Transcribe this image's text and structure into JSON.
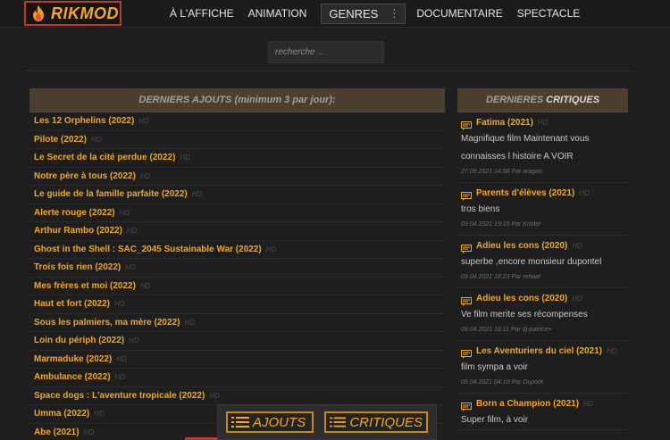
{
  "header": {
    "logo_text": "RIKMOD",
    "nav": [
      "À L'AFFICHE",
      "ANIMATION"
    ],
    "genres_label": "GENRES",
    "nav_after": [
      "DOCUMENTAIRE",
      "SPECTACLE"
    ]
  },
  "search": {
    "placeholder": "recherche ..."
  },
  "latest": {
    "heading": "DERNIERS AJOUTS (minimum 3 par jour):",
    "hd_label": "HD",
    "items": [
      "Les 12 Orphelins (2022)",
      "Pilote (2022)",
      "Le Secret de la cité perdue (2022)",
      "Notre père à tous (2022)",
      "Le guide de la famille parfaite (2022)",
      "Alerte rouge (2022)",
      "Arthur Rambo (2022)",
      "Ghost in the Shell : SAC_2045 Sustainable War (2022)",
      "Trois fois rien (2022)",
      "Mes frères et moi (2022)",
      "Haut et fort (2022)",
      "Sous les palmiers, ma mère (2022)",
      "Loin du périph (2022)",
      "Marmaduke (2022)",
      "Ambulance (2022)",
      "Space dogs : L'aventure tropicale (2022)",
      "Umma (2022)",
      "Abe (2021)"
    ]
  },
  "reviews": {
    "heading_a": "DERNIERES",
    "heading_b": "CRITIQUES",
    "hd_label": "HD",
    "items": [
      {
        "title": "Fatima (2021)",
        "text": "Magnifique film Maintenant vous connaisses l histoire A VOIR",
        "meta": "27.05.2021 14:58 Par aragon"
      },
      {
        "title": "Parents d'élèves (2021)",
        "text": "tros biens",
        "meta": "09.04.2021 19:15 Par Kristel"
      },
      {
        "title": "Adieu les cons (2020)",
        "text": "superbe ,encore monsieur dupontel",
        "meta": "09.04.2021 18:23 Par rehael"
      },
      {
        "title": "Adieu les cons (2020)",
        "text": "Ve film merite ses récompenses",
        "meta": "09.04.2021 18:11 Par dj-patrice+"
      },
      {
        "title": "Les Aventuriers du ciel (2021)",
        "text": "film sympa a voir",
        "meta": "09.04.2021 04:10 Par Dupont"
      },
      {
        "title": "Born a Champion (2021)",
        "text": "Super film, à voir",
        "meta": ""
      }
    ]
  },
  "floatbar": {
    "ajouts": "AJOUTS",
    "critiques": "CRITIQUES"
  },
  "colors": {
    "accent": "#f0a81c",
    "header_bg": "#4c3f2d",
    "logo_border": "#c0392b"
  }
}
